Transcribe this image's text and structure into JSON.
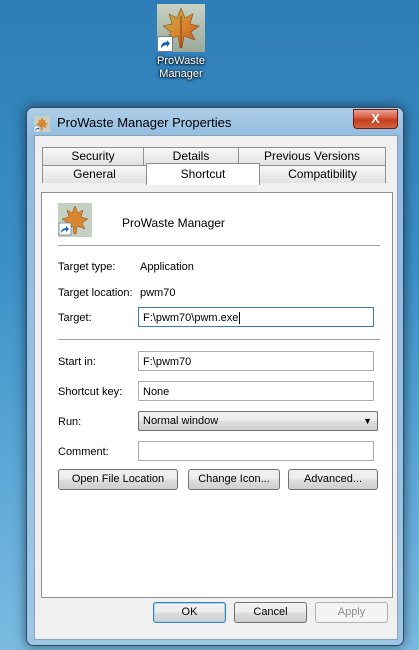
{
  "desktop": {
    "shortcut_label": "ProWaste\nManager"
  },
  "window": {
    "title": "ProWaste Manager Properties",
    "close_glyph": "X"
  },
  "tabs": {
    "row1": [
      "Security",
      "Details",
      "Previous Versions"
    ],
    "row2": [
      "General",
      "Shortcut",
      "Compatibility"
    ],
    "active": "Shortcut"
  },
  "shortcut": {
    "name": "ProWaste Manager",
    "target_type_label": "Target type:",
    "target_type_value": "Application",
    "target_location_label": "Target location:",
    "target_location_value": "pwm70",
    "target_label": "Target:",
    "target_value": "F:\\pwm70\\pwm.exe",
    "start_in_label": "Start in:",
    "start_in_value": "F:\\pwm70",
    "shortcut_key_label": "Shortcut key:",
    "shortcut_key_value": "None",
    "run_label": "Run:",
    "run_value": "Normal window",
    "comment_label": "Comment:",
    "comment_value": "",
    "open_file_location": "Open File Location",
    "change_icon": "Change Icon...",
    "advanced": "Advanced..."
  },
  "dialog_buttons": {
    "ok": "OK",
    "cancel": "Cancel",
    "apply": "Apply"
  },
  "colors": {
    "leaf_orange": "#d9862e",
    "leaf_green": "#8aa349",
    "shortcut_arrow": "#1c63b8"
  },
  "icons": {
    "app": "maple-leaf-icon",
    "shortcut_overlay": "shortcut-arrow-icon",
    "dropdown": "chevron-down-icon"
  }
}
